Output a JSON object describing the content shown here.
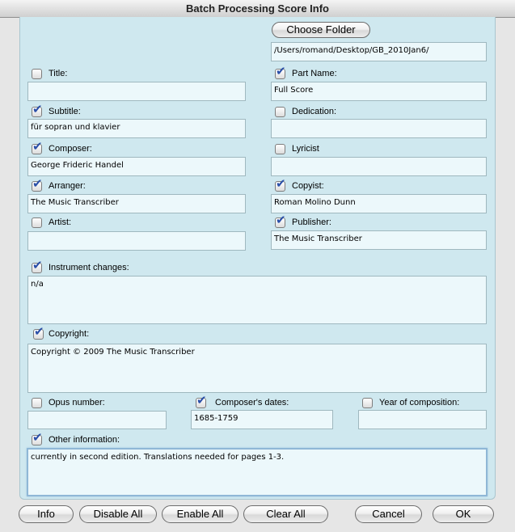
{
  "window": {
    "title": "Batch Processing Score Info"
  },
  "folder": {
    "button_label": "Choose Folder",
    "path": "/Users/romand/Desktop/GB_2010Jan6/"
  },
  "fields": {
    "title": {
      "label": "Title:",
      "checked": false,
      "value": ""
    },
    "part_name": {
      "label": "Part Name:",
      "checked": true,
      "value": "Full Score"
    },
    "subtitle": {
      "label": "Subtitle:",
      "checked": true,
      "value": "für sopran und klavier"
    },
    "dedication": {
      "label": "Dedication:",
      "checked": false,
      "value": ""
    },
    "composer": {
      "label": "Composer:",
      "checked": true,
      "value": "George Frideric Handel"
    },
    "lyricist": {
      "label": "Lyricist",
      "checked": false,
      "value": ""
    },
    "arranger": {
      "label": "Arranger:",
      "checked": true,
      "value": "The Music Transcriber"
    },
    "copyist": {
      "label": "Copyist:",
      "checked": true,
      "value": "Roman Molino Dunn"
    },
    "artist": {
      "label": "Artist:",
      "checked": false,
      "value": ""
    },
    "publisher": {
      "label": "Publisher:",
      "checked": true,
      "value": "The Music Transcriber"
    },
    "instrument_changes": {
      "label": "Instrument changes:",
      "checked": true,
      "value": "n/a"
    },
    "copyright": {
      "label": "Copyright:",
      "checked": true,
      "value": "Copyright © 2009 The Music Transcriber"
    },
    "opus_number": {
      "label": "Opus number:",
      "checked": false,
      "value": ""
    },
    "composers_dates": {
      "label": "Composer's dates:",
      "checked": true,
      "value": "1685-1759"
    },
    "year_of_composition": {
      "label": "Year of composition:",
      "checked": false,
      "value": ""
    },
    "other_information": {
      "label": "Other information:",
      "checked": true,
      "value": "currently in second edition. Translations needed for pages 1-3."
    }
  },
  "check_glyph": "✔",
  "buttons": {
    "info": "Info",
    "disable_all": "Disable All",
    "enable_all": "Enable All",
    "clear_all": "Clear All",
    "cancel": "Cancel",
    "ok": "OK"
  },
  "colors": {
    "panel_bg": "#cfe8ef",
    "field_bg": "#ecf8fb",
    "check": "#2a4fa8"
  }
}
